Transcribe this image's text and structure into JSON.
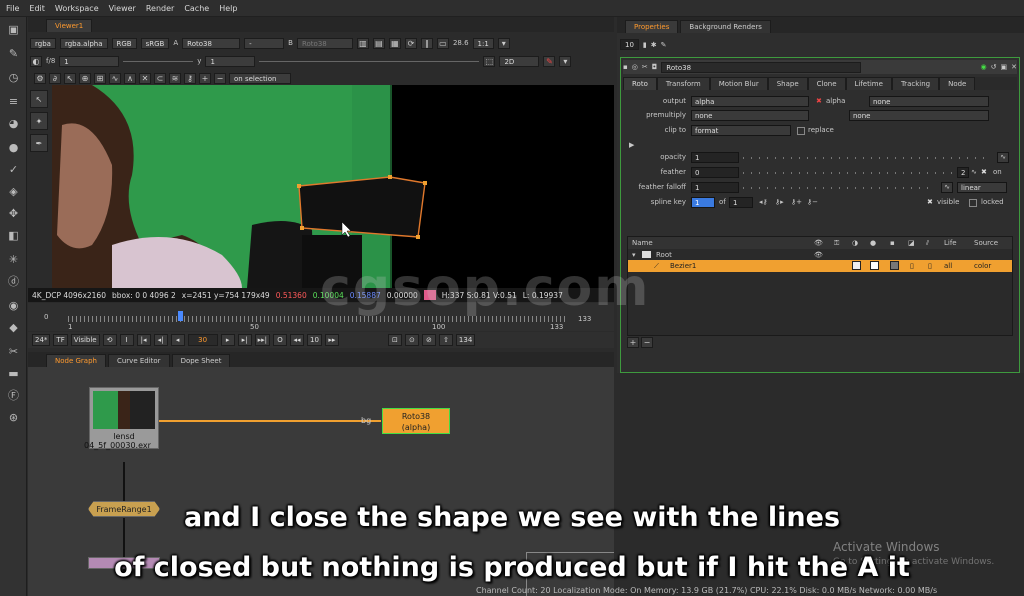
{
  "menu": [
    "File",
    "Edit",
    "Workspace",
    "Viewer",
    "Render",
    "Cache",
    "Help"
  ],
  "viewer": {
    "tab": "Viewer1",
    "toolbar1": {
      "channels": "rgba",
      "alpha": "rgba.alpha",
      "colorspace": "RGB",
      "lut": "sRGB",
      "a_label": "A",
      "a_input": "Roto38",
      "dash": "-",
      "b_label": "B",
      "b_input": "Roto38",
      "fstop": "28.6",
      "zoom": "1:1"
    },
    "toolbar2": {
      "fstop_label": "f/8",
      "frame_val": "1",
      "y_label": "y",
      "y_val": "1",
      "mode2d": "2D"
    },
    "toolbar3": {
      "selection": "on selection"
    },
    "status": {
      "format": "4K_DCP 4096x2160",
      "bbox": "bbox: 0 0 4096 2",
      "coords": "x=2451 y=754 179x49",
      "r": "0.51360",
      "g": "0.10004",
      "b": "0.15887",
      "a": "0.00000",
      "hsv": "H:337 S:0.81 V:0.51",
      "l": "L: 0.19937"
    },
    "timeline": {
      "start": "0",
      "t1": "1",
      "t50": "50",
      "t100": "100",
      "t133": "133",
      "end": "133"
    },
    "playbar": {
      "fps": "24*",
      "tf": "TF",
      "visible": "Visible",
      "frame": "30",
      "step": "10",
      "last": "134"
    }
  },
  "bottom_tabs": [
    "Node Graph",
    "Curve Editor",
    "Dope Sheet"
  ],
  "nodes": {
    "read_name": "lensd",
    "read_file": "04_5f_00030.exr",
    "roto_name": "Roto38",
    "roto_sub": "(alpha)",
    "bg_label": "bg",
    "framerange": "FrameRange1"
  },
  "properties": {
    "tabs": [
      "Properties",
      "Background Renders"
    ],
    "count": "10",
    "node_name": "Roto38",
    "subtabs": [
      "Roto",
      "Transform",
      "Motion Blur",
      "Shape",
      "Clone",
      "Lifetime",
      "Tracking",
      "Node"
    ],
    "output_label": "output",
    "output_val": "alpha",
    "alpha_chk": "alpha",
    "output_none": "none",
    "premult_label": "premultiply",
    "premult_val": "none",
    "premult_none": "none",
    "clip_label": "clip to",
    "clip_val": "format",
    "replace": "replace",
    "opacity_label": "opacity",
    "opacity_val": "1",
    "feather_label": "feather",
    "feather_val": "0",
    "feather_n": "2",
    "on": "on",
    "falloff_label": "feather falloff",
    "falloff_val": "1",
    "falloff_mode": "linear",
    "spline_label": "spline key",
    "spline_val": "1",
    "of": "of",
    "of_val": "1",
    "visible": "visible",
    "locked": "locked",
    "cols": [
      "Name",
      "Life",
      "Source"
    ],
    "tree": {
      "root": "Root",
      "bezier": "Bezier1",
      "life": "all",
      "source": "color"
    }
  },
  "subtitles": [
    "and I close the shape we see with the lines",
    "of closed but nothing is produced but if I hit the A it"
  ],
  "watermark": "cgsop.com",
  "activate": {
    "title": "Activate Windows",
    "sub": "Go to Settings to activate Windows."
  },
  "bottomstatus": "Channel Count: 20 Localization Mode: On Memory: 13.9 GB (21.7%) CPU: 22.1% Disk: 0.0 MB/s Network: 0.00 MB/s",
  "colors": {
    "accent": "#ff9a2e",
    "green": "#3a9a3a",
    "nodeOrange": "#f0a030"
  }
}
